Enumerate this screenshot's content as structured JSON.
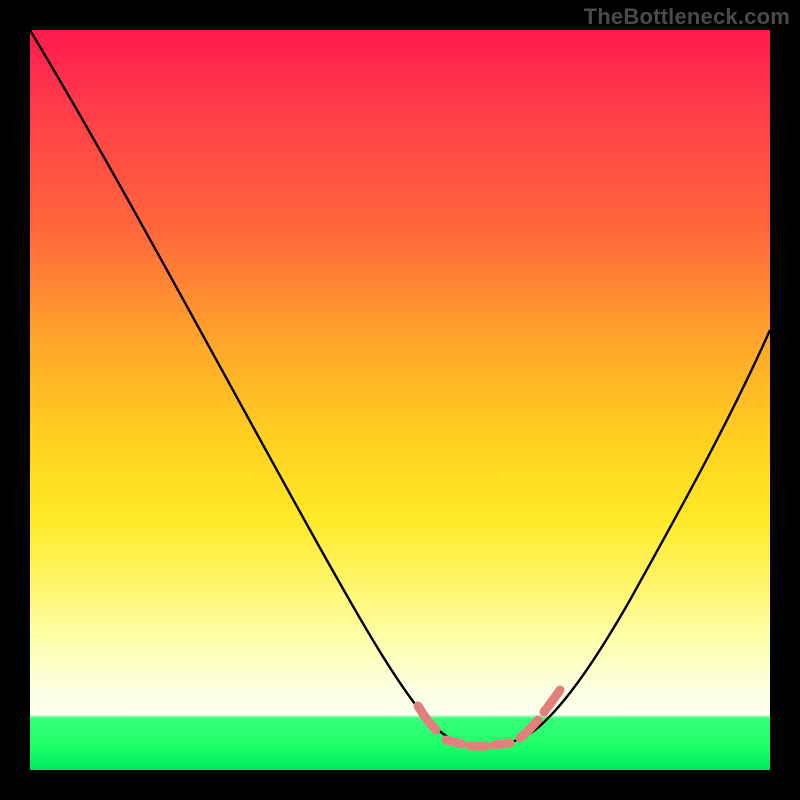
{
  "watermark": "TheBottleneck.com",
  "colors": {
    "background": "#000000",
    "gradient_top": "#ff1a4d",
    "gradient_bottom": "#00e85e",
    "curve": "#000000",
    "highlight": "#e37f7c"
  },
  "chart_data": {
    "type": "line",
    "title": "",
    "xlabel": "",
    "ylabel": "",
    "xlim": [
      0,
      100
    ],
    "ylim": [
      0,
      100
    ],
    "grid": false,
    "legend": false,
    "series": [
      {
        "name": "bottleneck-curve",
        "x": [
          0,
          5,
          10,
          15,
          20,
          25,
          30,
          35,
          40,
          45,
          50,
          52,
          55,
          58,
          60,
          62,
          65,
          68,
          70,
          75,
          80,
          85,
          90,
          95,
          100
        ],
        "values": [
          100,
          92,
          83,
          74,
          65,
          56,
          47,
          38,
          29,
          20,
          12,
          9,
          5,
          3,
          2,
          2,
          2,
          3,
          5,
          10,
          18,
          28,
          38,
          49,
          60
        ]
      }
    ],
    "annotations": [
      {
        "name": "optimal-range-highlight",
        "x_range": [
          52,
          70
        ],
        "style": "dashed-pink-over-curve"
      }
    ]
  }
}
